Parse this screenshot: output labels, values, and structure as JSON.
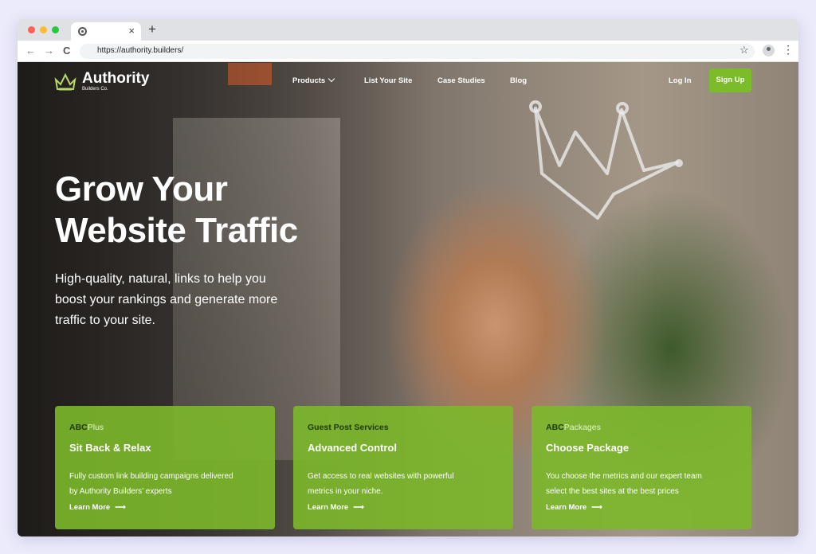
{
  "browser": {
    "tab_close": "×",
    "new_tab": "+",
    "url": "https://authority.builders/",
    "back": "←",
    "forward": "→",
    "reload": "C",
    "bookmark_star": "☆",
    "menu": "⋮"
  },
  "header": {
    "logo_name": "Authority",
    "logo_sub": "Builders Co.",
    "nav": {
      "products": "Products",
      "list_your_site": "List Your Site",
      "case_studies": "Case Studies",
      "blog": "Blog"
    },
    "login": "Log In",
    "signup": "Sign Up"
  },
  "hero": {
    "title_line1": "Grow Your",
    "title_line2": "Website Traffic",
    "sub_line1": "High-quality, natural, links to help you",
    "sub_line2": "boost your rankings and generate more",
    "sub_line3": "traffic to your site."
  },
  "cards": [
    {
      "eyebrow_bold": "ABC",
      "eyebrow_light": "Plus",
      "title": "Sit Back & Relax",
      "desc_line1": "Fully custom link building campaigns delivered",
      "desc_line2": "by Authority Builders’ experts",
      "cta": "Learn More"
    },
    {
      "eyebrow_bold": "Guest Post Services",
      "eyebrow_light": "",
      "title": "Advanced Control",
      "desc_line1": "Get access to real websites with powerful",
      "desc_line2": "metrics in your niche.",
      "cta": "Learn More"
    },
    {
      "eyebrow_bold": "ABC",
      "eyebrow_light": "Packages",
      "title": "Choose Package",
      "desc_line1": "You choose the metrics and our expert team",
      "desc_line2": "select the best sites at the best prices",
      "cta": "Learn More"
    }
  ],
  "colors": {
    "brand_green": "#7cbb2a",
    "card_green": "#7cb82a",
    "eyebrow_dark": "#1e3a0a"
  }
}
